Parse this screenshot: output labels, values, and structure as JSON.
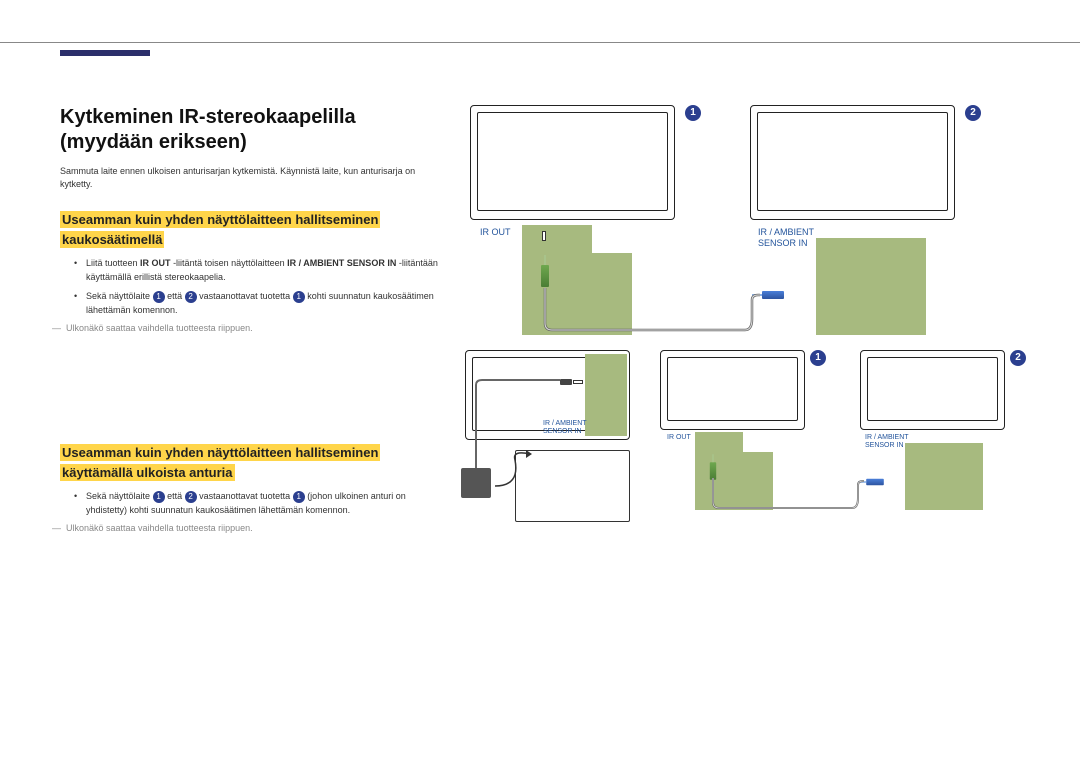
{
  "title": "Kytkeminen IR-stereokaapelilla (myydään erikseen)",
  "intro": "Sammuta laite ennen ulkoisen anturisarjan kytkemistä. Käynnistä laite, kun anturisarja on kytketty.",
  "section1": {
    "heading1": "Useamman kuin yhden näyttölaitteen hallitseminen",
    "heading2": "kaukosäätimellä",
    "bullet1a": "Liitä tuotteen ",
    "bullet1b": "IR OUT",
    "bullet1c": " -liitäntä toisen näyttölaitteen ",
    "bullet1d": "IR / AMBIENT SENSOR IN",
    "bullet1e": " -liitäntään käyttämällä erillistä stereokaapelia.",
    "bullet2a": "Sekä näyttölaite ",
    "bullet2b": " että ",
    "bullet2c": " vastaanottavat tuotetta ",
    "bullet2d": " kohti suunnatun kaukosäätimen lähettämän komennon.",
    "note": "Ulkonäkö saattaa vaihdella tuotteesta riippuen."
  },
  "section2": {
    "heading1": "Useamman kuin yhden näyttölaitteen hallitseminen",
    "heading2": "käyttämällä ulkoista anturia",
    "bullet1a": "Sekä näyttölaite ",
    "bullet1b": " että ",
    "bullet1c": " vastaanottavat tuotetta ",
    "bullet1d": " (johon ulkoinen anturi on yhdistetty) kohti suunnatun kaukosäätimen lähettämän komennon.",
    "note": "Ulkonäkö saattaa vaihdella tuotteesta riippuen."
  },
  "labels": {
    "irout": "IR OUT",
    "irambient": "IR / AMBIENT",
    "sensorin": "SENSOR IN",
    "irambientsensorin1": "IR / AMBIENT",
    "irambientsensorin2": "SENSOR IN",
    "irout2": "IR OUT",
    "irambient3": "IR / AMBIENT",
    "sensorin3": "SENSOR IN"
  },
  "nums": {
    "one": "1",
    "two": "2"
  }
}
